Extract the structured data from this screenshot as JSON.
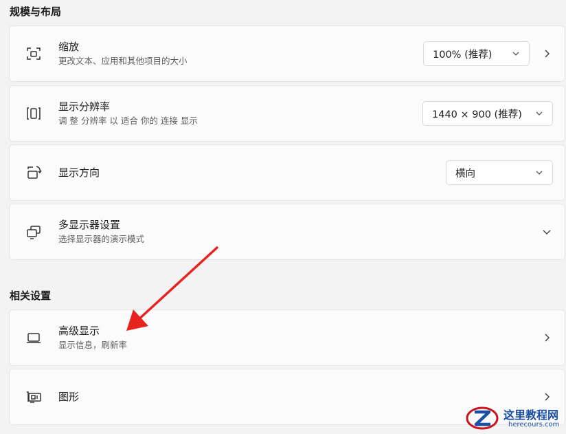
{
  "sections": {
    "scale_layout": "规模与布局",
    "related": "相关设置"
  },
  "scale": {
    "title": "缩放",
    "subtitle": "更改文本、应用和其他项目的大小",
    "value": "100% (推荐)"
  },
  "resolution": {
    "title": "显示分辨率",
    "subtitle": "调 整 分辨率 以 适合 你的 连接 显示",
    "value": "1440 × 900 (推荐)"
  },
  "orientation": {
    "title": "显示方向",
    "value": "横向"
  },
  "multi_display": {
    "title": "多显示器设置",
    "subtitle": "选择显示器的演示模式"
  },
  "advanced_display": {
    "title": "高级显示",
    "subtitle": "显示信息，刷新率"
  },
  "graphics": {
    "title": "图形"
  },
  "watermark": {
    "cn": "这里教程网",
    "en": "herecours.com"
  },
  "colors": {
    "background": "#f3f3f3",
    "card": "#fbfbfb",
    "annotation_arrow": "#e8231f",
    "watermark": "#1a4fa3"
  },
  "icons": {
    "scale": "scale-icon",
    "resolution": "resolution-icon",
    "orientation": "orientation-icon",
    "multi_display": "multi-display-icon",
    "advanced_display": "laptop-icon",
    "graphics": "graphics-card-icon"
  }
}
